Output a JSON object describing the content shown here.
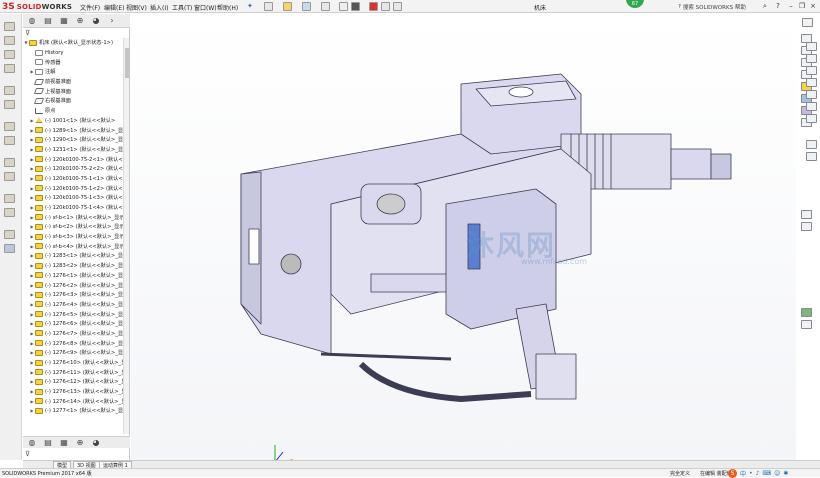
{
  "app": {
    "logo_mark": "3S",
    "logo_text_1": "SOLID",
    "logo_text_2": "WORKS",
    "document_title": "机床",
    "badge": "67"
  },
  "menu": {
    "items": [
      "文件(F)",
      "编辑(E)",
      "视图(V)",
      "插入(I)",
      "工具(T)",
      "窗口(W)",
      "帮助(H)"
    ]
  },
  "search": {
    "placeholder": "搜索 SOLIDWORKS 帮助"
  },
  "feature_manager": {
    "filter_icon": "filter-icon",
    "root": "机床 (默认<默认_显示状态-1>)",
    "items": [
      {
        "label": "History",
        "icon": "folder",
        "expand": ""
      },
      {
        "label": "传感器",
        "icon": "folder",
        "expand": ""
      },
      {
        "label": "注解",
        "icon": "folder",
        "expand": "▶"
      },
      {
        "label": "前视基准面",
        "icon": "plane",
        "expand": ""
      },
      {
        "label": "上视基准面",
        "icon": "plane",
        "expand": ""
      },
      {
        "label": "右视基准面",
        "icon": "plane",
        "expand": ""
      },
      {
        "label": "原点",
        "icon": "origin",
        "expand": ""
      },
      {
        "label": "(-) 1001<1> (默认<<默认>",
        "icon": "warn",
        "expand": "▶"
      },
      {
        "label": "(-) 1289<1> (默认<<默认>_显示",
        "icon": "part",
        "expand": "▶"
      },
      {
        "label": "(-) 1290<1> (默认<<默认>_显示",
        "icon": "part",
        "expand": "▶"
      },
      {
        "label": "(-) 1231<1> (默认<<默认>_显示",
        "icon": "part",
        "expand": "▶"
      },
      {
        "label": "(-) 120k0100-75-2<1> (默认<<",
        "icon": "part",
        "expand": "▶"
      },
      {
        "label": "(-) 120k0100-75-2<2> (默认<<",
        "icon": "part",
        "expand": "▶"
      },
      {
        "label": "(-) 120k0100-75-1<1> (默认<<",
        "icon": "part",
        "expand": "▶"
      },
      {
        "label": "(-) 120k0100-75-1<2> (默认<<",
        "icon": "part",
        "expand": "▶"
      },
      {
        "label": "(-) 120k0100-75-1<3> (默认<<",
        "icon": "part",
        "expand": "▶"
      },
      {
        "label": "(-) 120k0100-75-1<4> (默认<<",
        "icon": "part",
        "expand": "▶"
      },
      {
        "label": "(-) sf-b<1> (默认<<默认>_显示",
        "icon": "part",
        "expand": "▶"
      },
      {
        "label": "(-) sf-b<2> (默认<<默认>_显示",
        "icon": "part",
        "expand": "▶"
      },
      {
        "label": "(-) sf-b<3> (默认<<默认>_显示",
        "icon": "part",
        "expand": "▶"
      },
      {
        "label": "(-) sf-b<4> (默认<<默认>_显示",
        "icon": "part",
        "expand": "▶"
      },
      {
        "label": "(-) 1283<1> (默认<<默认>_显示",
        "icon": "part",
        "expand": "▶"
      },
      {
        "label": "(-) 1283<2> (默认<<默认>_显示",
        "icon": "part",
        "expand": "▶"
      },
      {
        "label": "(-) 1276<1> (默认<<默认>_显示",
        "icon": "part",
        "expand": "▶"
      },
      {
        "label": "(-) 1276<2> (默认<<默认>_显示",
        "icon": "part",
        "expand": "▶"
      },
      {
        "label": "(-) 1276<3> (默认<<默认>_显示",
        "icon": "part",
        "expand": "▶"
      },
      {
        "label": "(-) 1276<4> (默认<<默认>_显示",
        "icon": "part",
        "expand": "▶"
      },
      {
        "label": "(-) 1276<5> (默认<<默认>_显示",
        "icon": "part",
        "expand": "▶"
      },
      {
        "label": "(-) 1276<6> (默认<<默认>_显示",
        "icon": "part",
        "expand": "▶"
      },
      {
        "label": "(-) 1276<7> (默认<<默认>_显示",
        "icon": "part",
        "expand": "▶"
      },
      {
        "label": "(-) 1276<8> (默认<<默认>_显示",
        "icon": "part",
        "expand": "▶"
      },
      {
        "label": "(-) 1276<9> (默认<<默认>_显示",
        "icon": "part",
        "expand": "▶"
      },
      {
        "label": "(-) 1276<10> (默认<<默认>_显",
        "icon": "part",
        "expand": "▶"
      },
      {
        "label": "(-) 1276<11> (默认<<默认>_显",
        "icon": "part",
        "expand": "▶"
      },
      {
        "label": "(-) 1276<12> (默认<<默认>_显",
        "icon": "part",
        "expand": "▶"
      },
      {
        "label": "(-) 1276<13> (默认<<默认>_显",
        "icon": "part",
        "expand": "▶"
      },
      {
        "label": "(-) 1276<14> (默认<<默认>_显",
        "icon": "part",
        "expand": "▶"
      },
      {
        "label": "(-) 1277<1> (默认<<默认>_显示",
        "icon": "part",
        "expand": "▶"
      }
    ]
  },
  "watermark": {
    "text": "沐风网",
    "sub": "www.mfcad.com"
  },
  "bottom_tabs": [
    "模型",
    "3D 视图",
    "运动算例 1"
  ],
  "status": {
    "left": "SOLIDWORKS Premium 2017 x64 版",
    "right": "完全定义",
    "editing": "在编辑 装配体",
    "ime_logo": "S",
    "ime_mode": "中"
  },
  "colors": {
    "model_fill": "#d9d8ee",
    "model_stroke": "#3c3c54",
    "accent_red": "#d2232a",
    "ime_blue": "#1f6fc4"
  }
}
